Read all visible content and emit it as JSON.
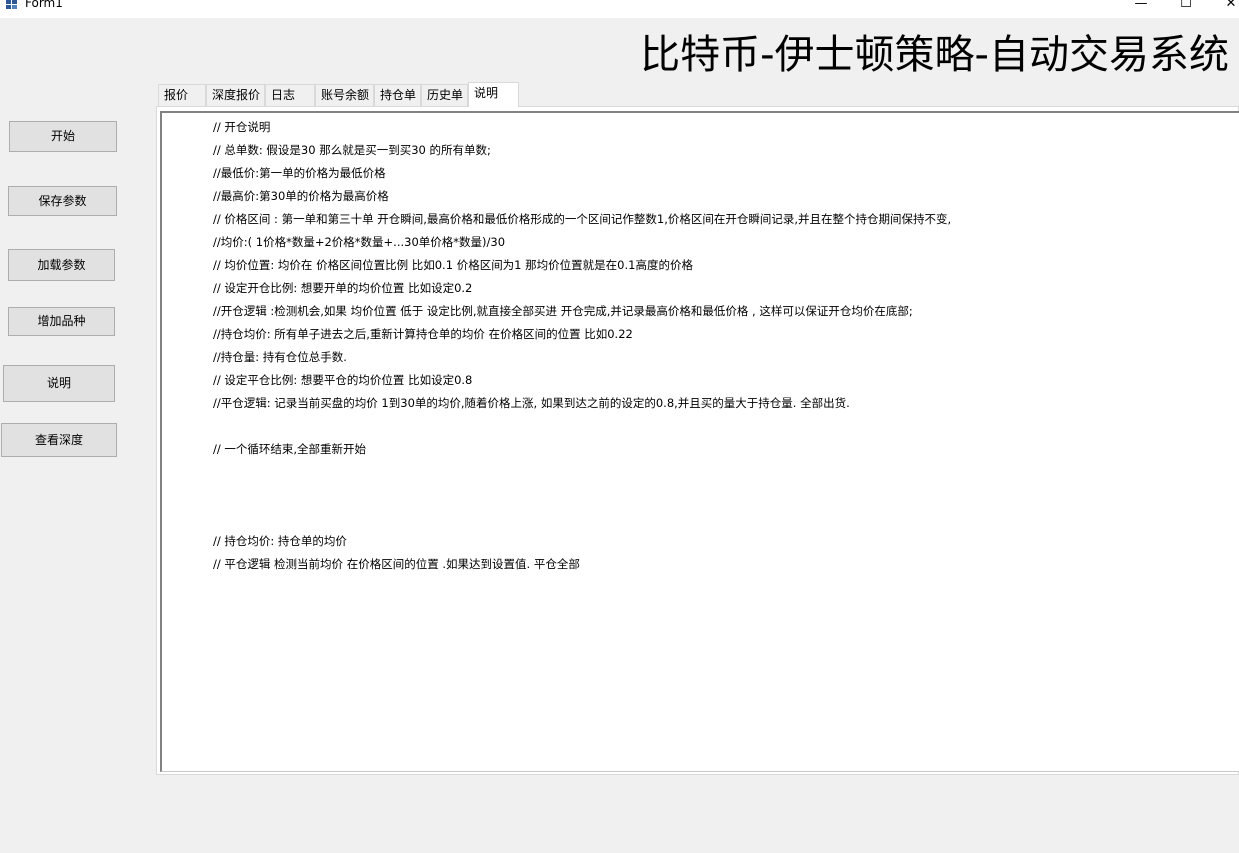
{
  "window": {
    "title": "Form1",
    "min": "—",
    "max": "☐",
    "close": "✕"
  },
  "headline": "比特币-伊士顿策略-自动交易系统",
  "buttons": {
    "start": "开始",
    "save_params": "保存参数",
    "load_params": "加载参数",
    "add_symbol": "增加品种",
    "help": "说明",
    "view_depth": "查看深度"
  },
  "tabs": [
    {
      "label": "报价"
    },
    {
      "label": "深度报价"
    },
    {
      "label": "日志"
    },
    {
      "label": "账号余额"
    },
    {
      "label": "持仓单"
    },
    {
      "label": "历史单"
    },
    {
      "label": "说明",
      "active": true
    }
  ],
  "description_lines": [
    "// 开仓说明",
    "// 总单数: 假设是30 那么就是买一到买30 的所有单数;",
    "//最低价:第一单的价格为最低价格",
    "//最高价:第30单的价格为最高价格",
    "// 价格区间 : 第一单和第三十单 开仓瞬间,最高价格和最低价格形成的一个区间记作整数1,价格区间在开仓瞬间记录,并且在整个持仓期间保持不变,",
    "//均价:( 1价格*数量+2价格*数量+...30单价格*数量)/30",
    "// 均价位置:  均价在 价格区间位置比例 比如0.1 价格区间为1 那均价位置就是在0.1高度的价格",
    "// 设定开仓比例: 想要开单的均价位置 比如设定0.2",
    "//开仓逻辑 :检测机会,如果 均价位置 低于 设定比例,就直接全部买进 开仓完成,并记录最高价格和最低价格 , 这样可以保证开仓均价在底部;",
    "//持仓均价: 所有单子进去之后,重新计算持仓单的均价 在价格区间的位置 比如0.22",
    "//持仓量: 持有仓位总手数.",
    "// 设定平仓比例: 想要平仓的均价位置 比如设定0.8",
    "//平仓逻辑:  记录当前买盘的均价 1到30单的均价,随着价格上涨, 如果到达之前的设定的0.8,并且买的量大于持仓量. 全部出货.",
    "// 一个循环结束,全部重新开始",
    "// 持仓均价: 持仓单的均价",
    "// 平仓逻辑 检测当前均价 在价格区间的位置 .如果达到设置值. 平仓全部"
  ]
}
